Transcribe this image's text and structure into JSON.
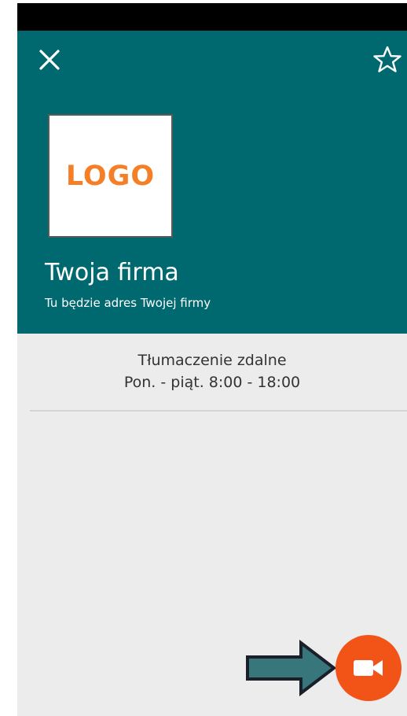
{
  "header": {
    "logo_text": "LOGO",
    "company_name": "Twoja firma",
    "company_address": "Tu będzie adres Twojej firmy",
    "background_color": "#00696f",
    "close_icon": "close-icon",
    "favorite_icon": "star-outline-icon"
  },
  "service": {
    "name": "Tłumaczenie zdalne",
    "hours": "Pon. - piąt. 8:00 - 18:00"
  },
  "actions": {
    "video_call_icon": "video-camera-icon",
    "video_call_color": "#f25317",
    "pointer_icon": "arrow-right-icon",
    "pointer_color": "#37777b"
  }
}
